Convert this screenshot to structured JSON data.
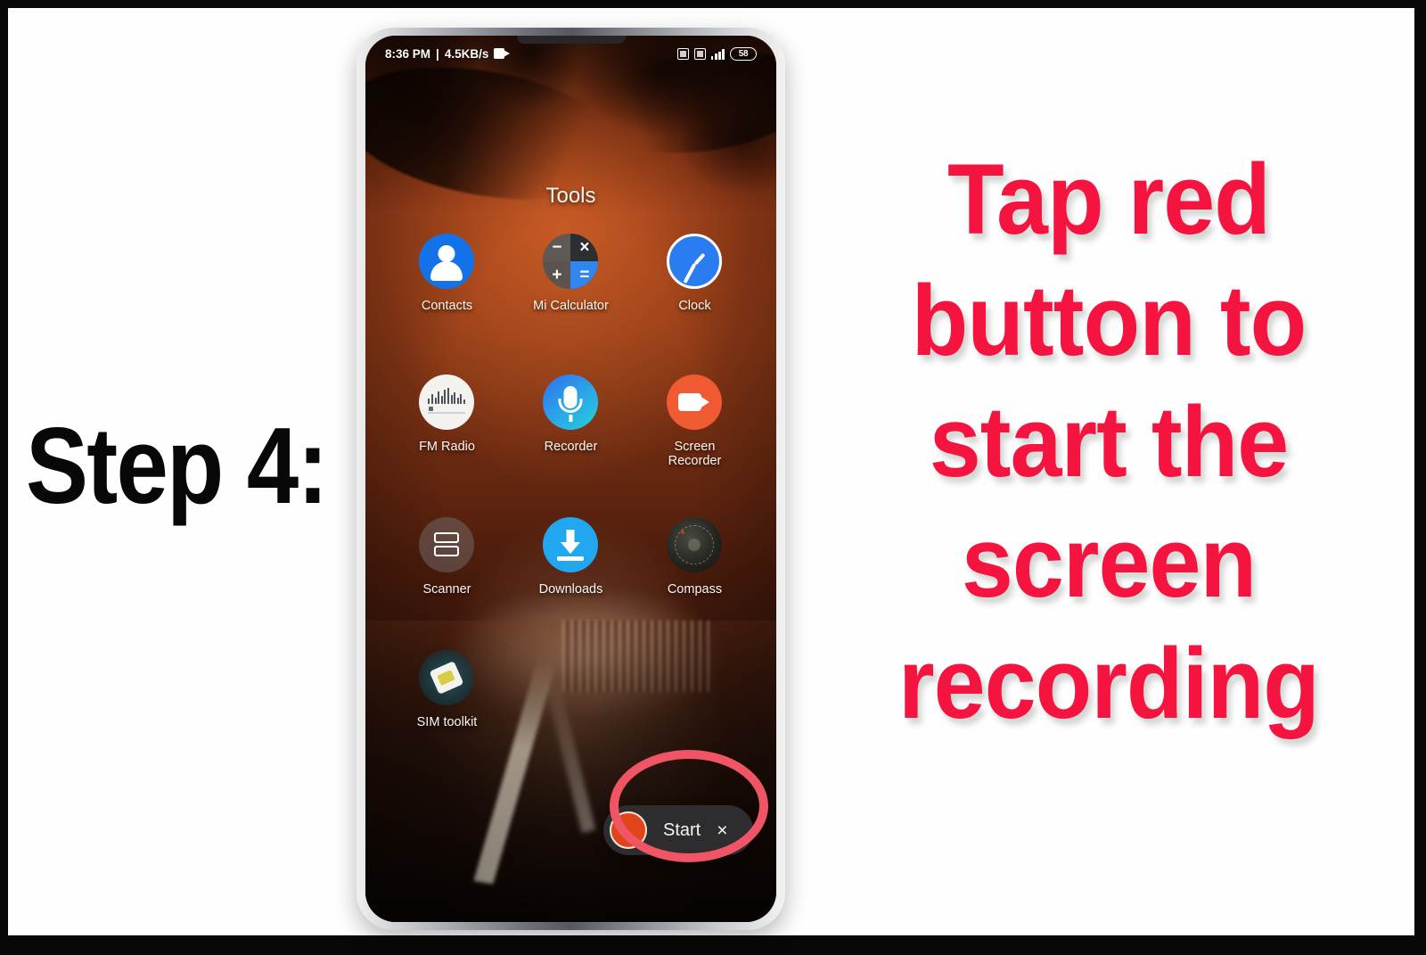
{
  "annotations": {
    "step_label": "Step 4:",
    "instruction_lines": [
      "Tap red",
      "button to",
      "start the",
      "screen",
      "recording"
    ],
    "highlight_circle_name": "red-highlight-circle",
    "red_color": "#f5143f",
    "highlight_color": "#f05566"
  },
  "phone": {
    "status_bar": {
      "time": "8:36 PM",
      "separator": "|",
      "network_speed": "4.5KB/s",
      "recording_icon": "screen-record-icon",
      "right_icons": [
        "app-badge-icon",
        "dnd-icon",
        "signal-bars-icon"
      ],
      "battery": "58"
    },
    "folder": {
      "title": "Tools"
    },
    "apps": [
      [
        {
          "label": "Contacts",
          "icon": "contacts-icon",
          "color": "#1472e8"
        },
        {
          "label": "Mi Calculator",
          "icon": "calculator-icon",
          "color": "#2f86f0"
        },
        {
          "label": "Clock",
          "icon": "clock-icon",
          "color": "#2a7df0"
        }
      ],
      [
        {
          "label": "FM Radio",
          "icon": "fm-radio-icon",
          "color": "#f4f2ef"
        },
        {
          "label": "Recorder",
          "icon": "microphone-icon",
          "color": "#2aa8e8"
        },
        {
          "label": "Screen\nRecorder",
          "icon": "screen-recorder-icon",
          "color": "#ef5a32"
        }
      ],
      [
        {
          "label": "Scanner",
          "icon": "scanner-icon",
          "color": "#787678"
        },
        {
          "label": "Downloads",
          "icon": "download-arrow-icon",
          "color": "#21a6f0"
        },
        {
          "label": "Compass",
          "icon": "compass-icon",
          "color": "#22231f"
        }
      ],
      [
        {
          "label": "SIM toolkit",
          "icon": "sim-card-icon",
          "color": "#245c68"
        }
      ]
    ],
    "recorder_widget": {
      "record_button": "record-button",
      "start_label": "Start",
      "close_label": "×"
    }
  }
}
